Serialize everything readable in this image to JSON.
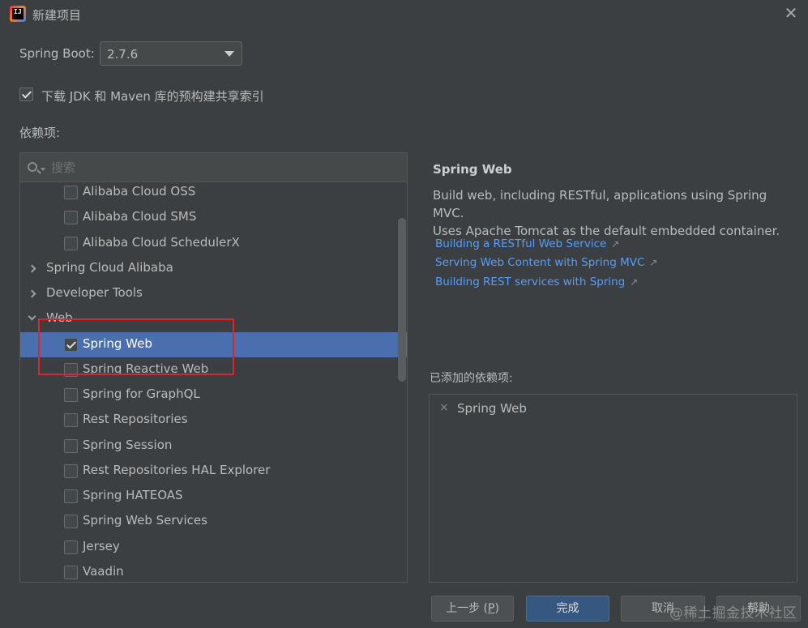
{
  "window": {
    "title": "新建项目",
    "app_icon_text": "IJ"
  },
  "spring_boot": {
    "label": "Spring Boot:",
    "selected_version": "2.7.6"
  },
  "download_index": {
    "label": "下载 JDK 和 Maven 库的预构建共享索引",
    "checked": true
  },
  "dependencies": {
    "label": "依赖项:",
    "search_placeholder": "搜索",
    "tree": [
      {
        "label": "Alibaba Cloud OSS",
        "type": "item",
        "checked": false
      },
      {
        "label": "Alibaba Cloud SMS",
        "type": "item",
        "checked": false
      },
      {
        "label": "Alibaba Cloud SchedulerX",
        "type": "item",
        "checked": false
      },
      {
        "label": "Spring Cloud Alibaba",
        "type": "group",
        "expanded": false
      },
      {
        "label": "Developer Tools",
        "type": "group",
        "expanded": false
      },
      {
        "label": "Web",
        "type": "group",
        "expanded": true
      },
      {
        "label": "Spring Web",
        "type": "item",
        "checked": true,
        "selected": true
      },
      {
        "label": "Spring Reactive Web",
        "type": "item",
        "checked": false
      },
      {
        "label": "Spring for GraphQL",
        "type": "item",
        "checked": false
      },
      {
        "label": "Rest Repositories",
        "type": "item",
        "checked": false
      },
      {
        "label": "Spring Session",
        "type": "item",
        "checked": false
      },
      {
        "label": "Rest Repositories HAL Explorer",
        "type": "item",
        "checked": false
      },
      {
        "label": "Spring HATEOAS",
        "type": "item",
        "checked": false
      },
      {
        "label": "Spring Web Services",
        "type": "item",
        "checked": false
      },
      {
        "label": "Jersey",
        "type": "item",
        "checked": false
      },
      {
        "label": "Vaadin",
        "type": "item",
        "checked": false
      }
    ]
  },
  "detail": {
    "title": "Spring Web",
    "description_line1": "Build web, including RESTful, applications using Spring MVC.",
    "description_line2": "Uses Apache Tomcat as the default embedded container.",
    "links": [
      "Building a RESTful Web Service",
      "Serving Web Content with Spring MVC",
      "Building REST services with Spring"
    ],
    "external_arrow": "↗"
  },
  "added": {
    "label": "已添加的依赖项:",
    "items": [
      "Spring Web"
    ],
    "remove_glyph": "×"
  },
  "buttons": {
    "prev": "上一步 (",
    "prev_mnemonic": "P",
    "prev_suffix": ")",
    "finish": "完成",
    "cancel": "取消",
    "help": "帮助"
  },
  "watermark": "@稀土掘金技术社区",
  "colors": {
    "background": "#3c3f41",
    "selection": "#4b6eaf",
    "link": "#589df6",
    "primary_button": "#365880",
    "highlight_box": "#e0232d"
  }
}
